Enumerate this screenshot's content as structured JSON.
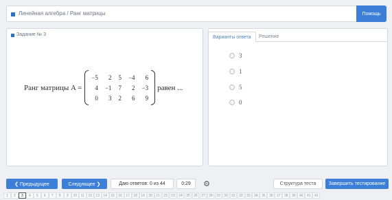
{
  "header": {
    "title": "Линейная алгебра / Ранг матрицы",
    "help_label": "Помощь"
  },
  "task": {
    "heading": "Задание № 3",
    "question_prefix": "Ранг матрицы A =",
    "question_suffix": "равен ...",
    "matrix": [
      [
        "−5",
        "2",
        "5",
        "−4",
        "6"
      ],
      [
        "4",
        "−1",
        "7",
        "2",
        "−3"
      ],
      [
        "0",
        "3",
        "2",
        "6",
        "9"
      ]
    ]
  },
  "answers": {
    "tabs": [
      "Варианты ответа",
      "Решение"
    ],
    "options": [
      "3",
      "1",
      "5",
      "0"
    ],
    "selected": null
  },
  "toolbar": {
    "prev_label": "❮ Предыдущее",
    "next_label": "Следующее ❯",
    "score_text": "Даю ответов: 0 из 44",
    "timer_text": "0:29",
    "questions_label": "Структура теста",
    "finish_label": "Завершить тестирование"
  },
  "pagination": {
    "pages": [
      "1",
      "2",
      "3",
      "4",
      "5",
      "6",
      "7",
      "8",
      "9",
      "10",
      "11",
      "12",
      "13",
      "14",
      "15",
      "16",
      "17",
      "18",
      "19",
      "20",
      "21",
      "22",
      "23",
      "24",
      "25",
      "26",
      "27",
      "28",
      "29",
      "30",
      "31",
      "32",
      "33",
      "34",
      "35",
      "36",
      "37",
      "38",
      "39",
      "40",
      "41",
      "42"
    ],
    "current": "3"
  },
  "colors": {
    "accent": "#3d7fd6",
    "background": "#eef0f3",
    "panel": "#ffffff",
    "border": "#d3d8de"
  }
}
